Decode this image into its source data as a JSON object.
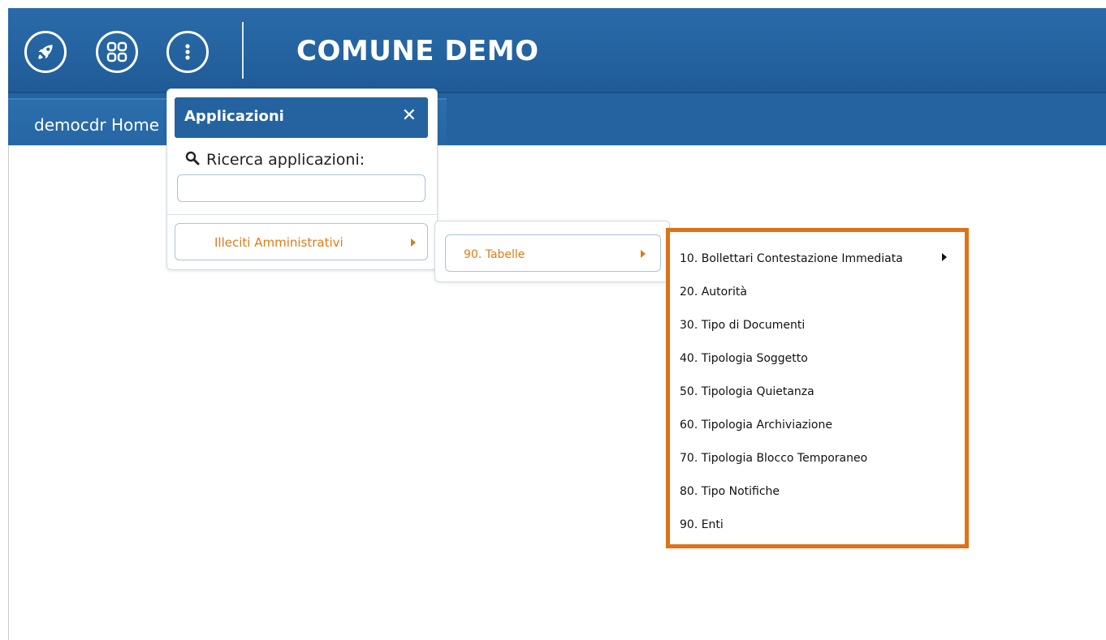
{
  "header": {
    "title": "COMUNE DEMO",
    "icons": [
      "rocket-icon",
      "apps-grid-icon",
      "more-vertical-icon"
    ],
    "bg_color": "#2463a0"
  },
  "tabs": {
    "home_label": "democdr Home"
  },
  "applications_panel": {
    "title": "Applicazioni",
    "close_label": "✕",
    "search_label": "Ricerca applicazioni:",
    "search_value": "",
    "search_placeholder": "",
    "items": [
      {
        "label": "Illeciti Amministrativi",
        "has_submenu": true
      }
    ]
  },
  "submenu_level2": {
    "items": [
      {
        "label": "90. Tabelle",
        "has_submenu": true
      }
    ]
  },
  "submenu_level3": {
    "highlight_color": "#e07116",
    "items": [
      {
        "label": "10. Bollettari Contestazione Immediata",
        "has_submenu": true
      },
      {
        "label": "20. Autorità",
        "has_submenu": false
      },
      {
        "label": "30. Tipo di Documenti",
        "has_submenu": false
      },
      {
        "label": "40. Tipologia Soggetto",
        "has_submenu": false
      },
      {
        "label": "50. Tipologia Quietanza",
        "has_submenu": false
      },
      {
        "label": "60. Tipologia Archiviazione",
        "has_submenu": false
      },
      {
        "label": "70. Tipologia Blocco Temporaneo",
        "has_submenu": false
      },
      {
        "label": "80. Tipo Notifiche",
        "has_submenu": false
      },
      {
        "label": "90. Enti",
        "has_submenu": false
      }
    ]
  },
  "colors": {
    "accent_orange": "#e07b17",
    "header_blue": "#2463a0"
  }
}
